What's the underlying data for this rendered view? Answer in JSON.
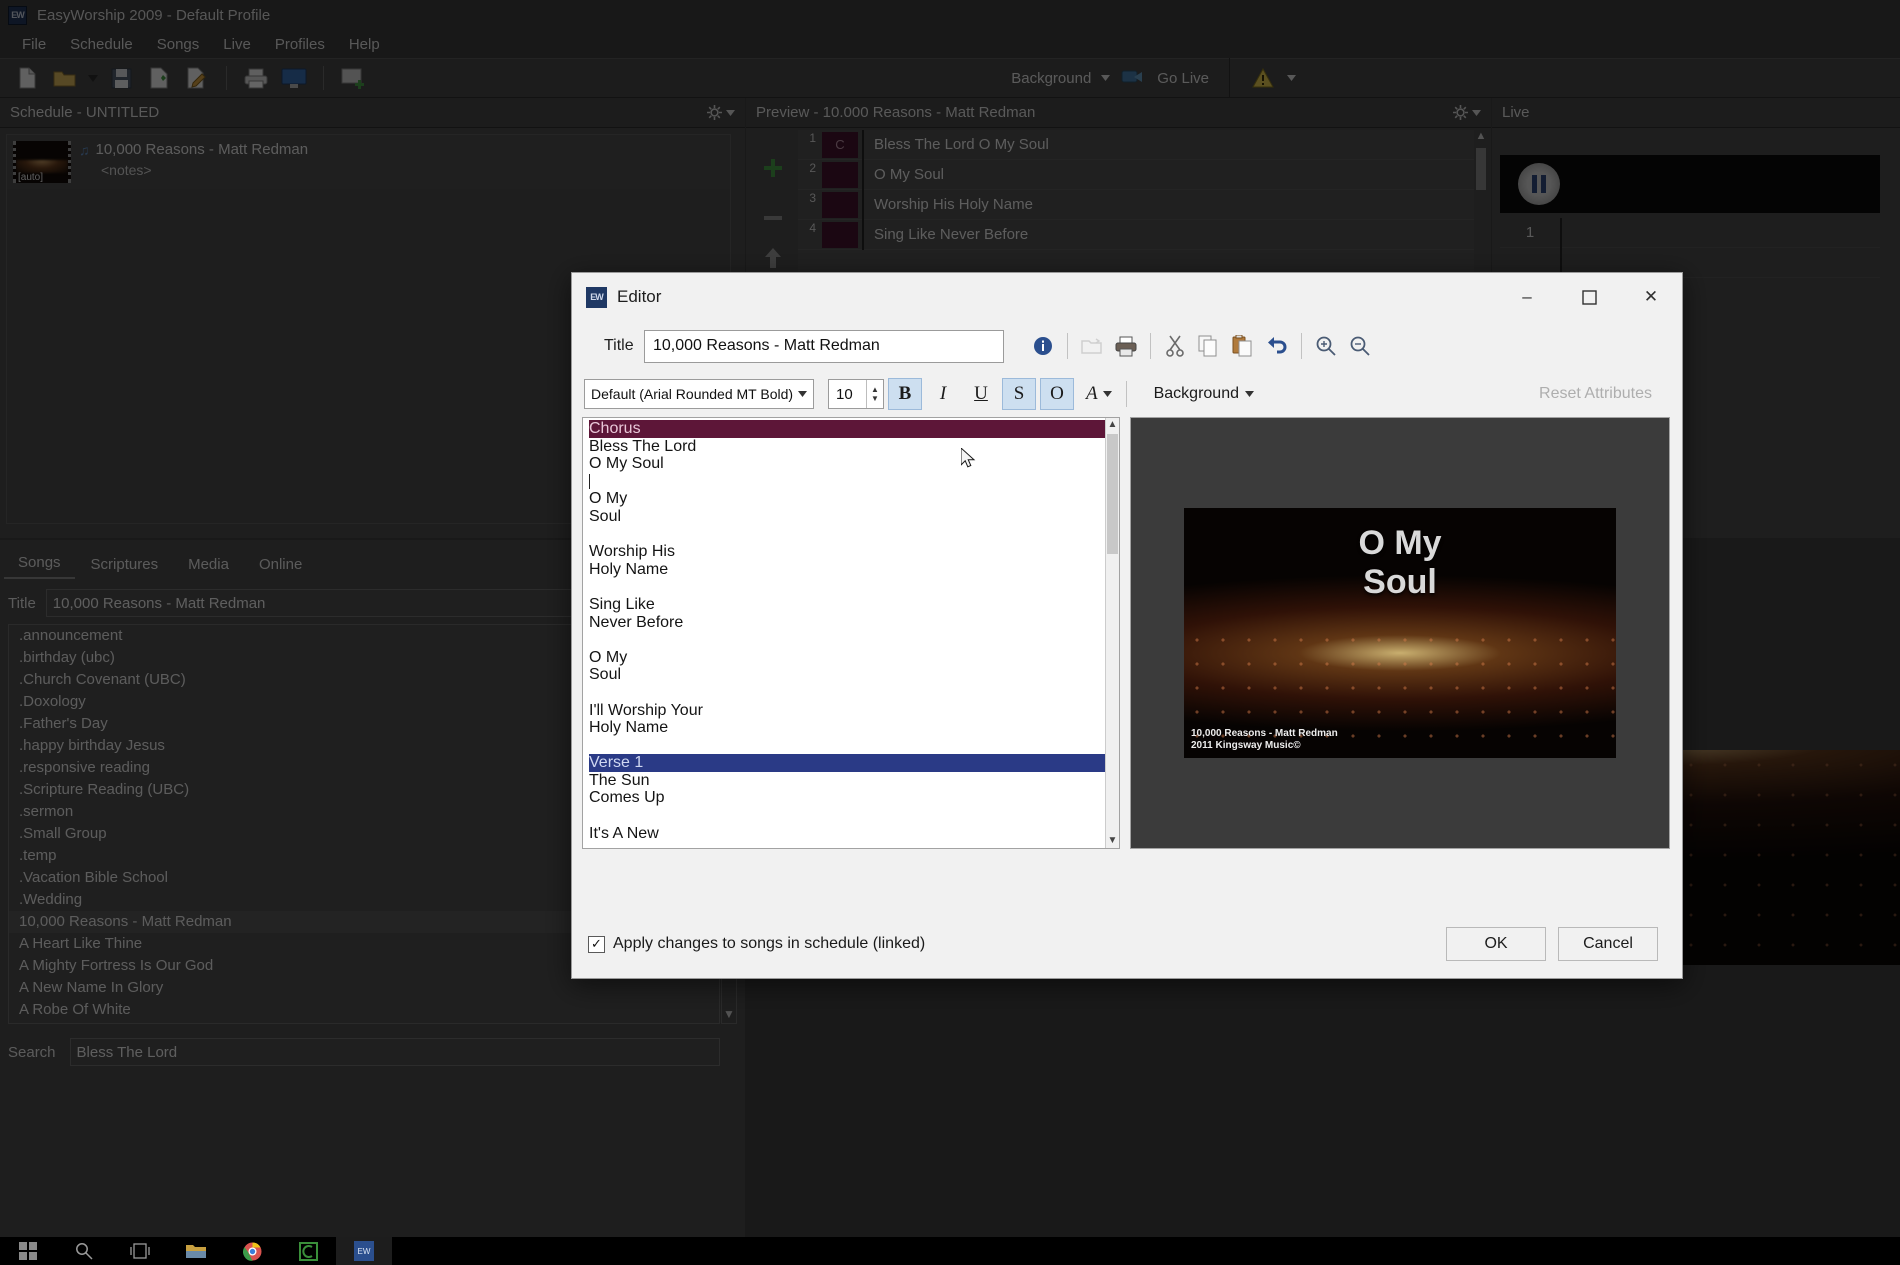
{
  "window": {
    "title": "EasyWorship 2009 - Default Profile",
    "app_icon": "EW"
  },
  "menu": {
    "items": [
      "File",
      "Schedule",
      "Songs",
      "Live",
      "Profiles",
      "Help"
    ]
  },
  "main_toolbar": {
    "icons": [
      "new-document-icon",
      "open-folder-icon",
      "dropdown-arrow-icon",
      "save-icon",
      "new-song-icon",
      "edit-song-icon",
      "print-icon",
      "display-icon",
      "add-presentation-icon"
    ],
    "background_label": "Background",
    "go_live_label": "Go Live",
    "alert_icon": "warning-triangle-icon"
  },
  "schedule": {
    "header": "Schedule - UNTITLED",
    "item_title": "10,000 Reasons - Matt Redman",
    "item_notes": "<notes>",
    "thumb_badge": "[auto]"
  },
  "preview": {
    "header": "Preview - 10.000 Reasons - Matt Redman",
    "side_icons": [
      "add-icon",
      "remove-icon",
      "move-up-icon"
    ],
    "rows": [
      {
        "num": "1",
        "swatch": "C",
        "label": "Bless The Lord O My Soul"
      },
      {
        "num": "2",
        "swatch": "",
        "label": "O My Soul"
      },
      {
        "num": "3",
        "swatch": "",
        "label": "Worship His Holy Name"
      },
      {
        "num": "4",
        "swatch": "",
        "label": "Sing Like Never Before"
      }
    ]
  },
  "live": {
    "header": "Live",
    "pause_icon": "pause-icon",
    "rows": [
      "1",
      ""
    ]
  },
  "library": {
    "tabs": [
      "Songs",
      "Scriptures",
      "Media",
      "Online"
    ],
    "active_tab": "Songs",
    "title_label": "Title",
    "title_value": "10,000 Reasons - Matt Redman",
    "songs": [
      ".announcement",
      ".birthday (ubc)",
      ".Church Covenant (UBC)",
      ".Doxology",
      ".Father's Day",
      ".happy birthday Jesus",
      ".responsive reading",
      ".Scripture Reading (UBC)",
      ".sermon",
      ".Small Group",
      ".temp",
      ".Vacation Bible School",
      ".Wedding",
      "10,000 Reasons - Matt Redman",
      "A Heart Like Thine",
      "A Mighty Fortress Is Our God",
      "A New Name In Glory",
      "A Robe Of White"
    ],
    "selected_song": "10,000 Reasons - Matt Redman",
    "search_label": "Search",
    "search_value": "Bless The Lord"
  },
  "status_bar": {
    "text": "10,000 Reasons - Matt Redman; 2011 Kingsway Music©"
  },
  "taskbar": {
    "items": [
      "start-icon",
      "search-icon",
      "task-view-icon",
      "file-explorer-icon",
      "chrome-icon",
      "camtasia-icon",
      "easyworship-icon"
    ],
    "active": "easyworship-icon"
  },
  "background_slides": [
    {
      "line1": "10,000 Reasons - Matt Redman",
      "line2": "2011 Kingsway Music©"
    },
    {
      "line1": "",
      "line2": ""
    }
  ],
  "editor": {
    "title": "Editor",
    "icon": "EW",
    "window_buttons": {
      "minimize": "–",
      "maximize": "❐",
      "close": "✕"
    },
    "title_label": "Title",
    "title_value": "10,000 Reasons - Matt Redman",
    "toolbar_icons": [
      "info-icon",
      "open-icon",
      "print-icon",
      "cut-icon",
      "copy-icon",
      "paste-icon",
      "undo-icon",
      "zoom-in-icon",
      "zoom-out-icon"
    ],
    "font_name": "Default (Arial Rounded MT Bold)",
    "font_size": "10",
    "style_buttons": [
      {
        "label": "B",
        "name": "bold-button",
        "active": true
      },
      {
        "label": "I",
        "name": "italic-button",
        "active": false
      },
      {
        "label": "U",
        "name": "underline-button",
        "active": false
      },
      {
        "label": "S",
        "name": "shadow-button",
        "active": true
      },
      {
        "label": "O",
        "name": "outline-button",
        "active": true
      }
    ],
    "font_color_label": "A",
    "background_label": "Background",
    "reset_attributes_label": "Reset Attributes",
    "lyrics": [
      {
        "text": "Chorus",
        "type": "chorus-header"
      },
      {
        "text": "Bless The Lord",
        "type": "line"
      },
      {
        "text": "O My Soul",
        "type": "line"
      },
      {
        "text": "",
        "type": "caret"
      },
      {
        "text": "O My",
        "type": "line"
      },
      {
        "text": "Soul",
        "type": "line"
      },
      {
        "text": "",
        "type": "blank"
      },
      {
        "text": "Worship His",
        "type": "line"
      },
      {
        "text": "Holy Name",
        "type": "line"
      },
      {
        "text": "",
        "type": "blank"
      },
      {
        "text": "Sing Like",
        "type": "line"
      },
      {
        "text": "Never Before",
        "type": "line"
      },
      {
        "text": "",
        "type": "blank"
      },
      {
        "text": "O My",
        "type": "line"
      },
      {
        "text": "Soul",
        "type": "line"
      },
      {
        "text": "",
        "type": "blank"
      },
      {
        "text": "I'll Worship Your",
        "type": "line"
      },
      {
        "text": "Holy Name",
        "type": "line"
      },
      {
        "text": "",
        "type": "blank"
      },
      {
        "text": "Verse 1",
        "type": "verse-header"
      },
      {
        "text": "The Sun",
        "type": "line"
      },
      {
        "text": "Comes Up",
        "type": "line"
      },
      {
        "text": "",
        "type": "blank"
      },
      {
        "text": "It's A New",
        "type": "line"
      }
    ],
    "slide_preview": {
      "line1": "O My",
      "line2": "Soul",
      "caption1": "10,000 Reasons - Matt Redman",
      "caption2": "2011 Kingsway Music©"
    },
    "apply_checkbox_label": "Apply changes to songs in schedule (linked)",
    "apply_checked": true,
    "ok_label": "OK",
    "cancel_label": "Cancel"
  },
  "colors": {
    "chorus_header_bg": "#5d1638",
    "verse_header_bg": "#2a3a86",
    "dialog_bg": "#f1f1f1",
    "app_bg": "#4a4a4a",
    "accent_blue": "#1f3864"
  }
}
